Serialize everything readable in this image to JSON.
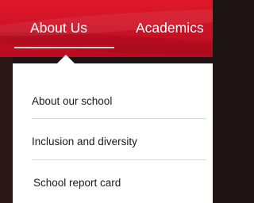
{
  "nav": {
    "tabs": [
      {
        "label": "About Us",
        "active": true
      },
      {
        "label": "Academics",
        "active": false
      }
    ],
    "accent_color": "#d01326"
  },
  "dropdown": {
    "items": [
      {
        "label": "About our school"
      },
      {
        "label": "Inclusion and diversity"
      },
      {
        "label": "School report card"
      }
    ]
  }
}
